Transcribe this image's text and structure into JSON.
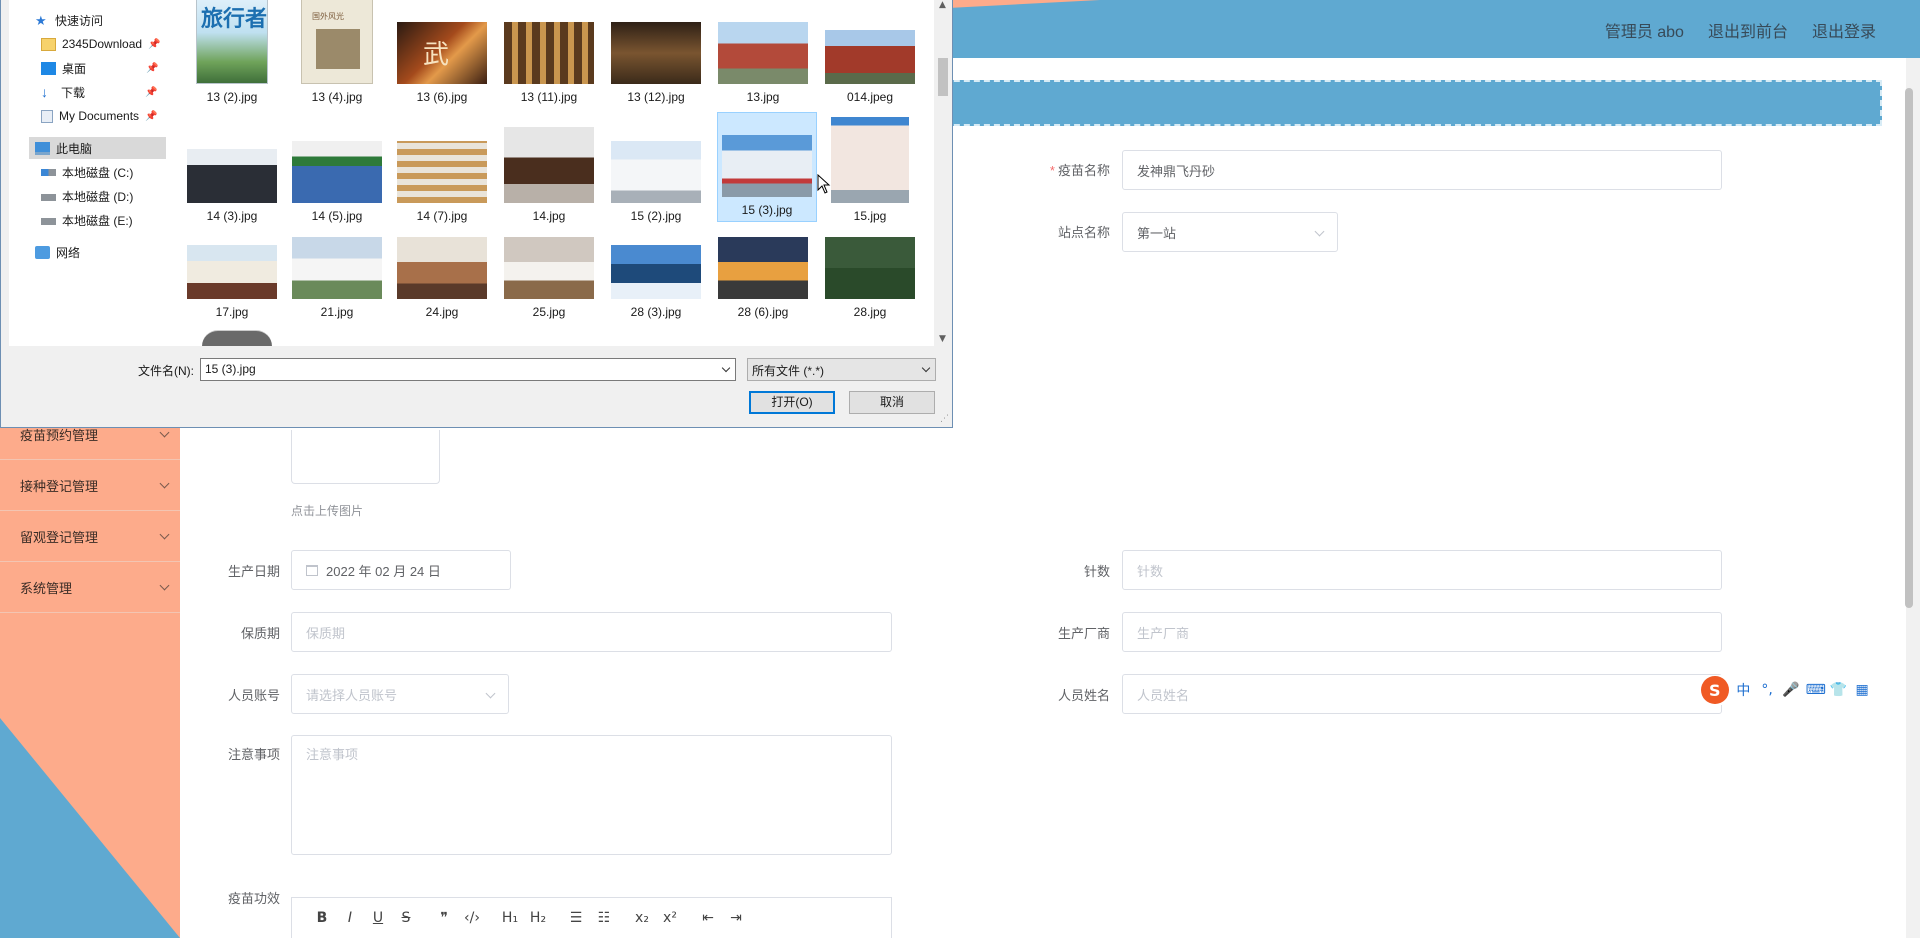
{
  "header": {
    "nav": [
      "管理员 abo",
      "退出到前台",
      "退出登录"
    ]
  },
  "sidebar": {
    "items": [
      "疫苗预约管理",
      "接种登记管理",
      "留观登记管理",
      "系统管理"
    ]
  },
  "form": {
    "vaccine_name": {
      "label": "疫苗名称",
      "value": "发神鼎飞丹砂"
    },
    "site_name": {
      "label": "站点名称",
      "value": "第一站"
    },
    "upload_hint": "点击上传图片",
    "prod_date": {
      "label": "生产日期",
      "value": "2022 年 02 月 24 日"
    },
    "doses": {
      "label": "针数",
      "placeholder": "针数"
    },
    "shelf_life": {
      "label": "保质期",
      "placeholder": "保质期"
    },
    "manufacturer": {
      "label": "生产厂商",
      "placeholder": "生产厂商"
    },
    "staff_account": {
      "label": "人员账号",
      "placeholder": "请选择人员账号"
    },
    "staff_name": {
      "label": "人员姓名",
      "placeholder": "人员姓名"
    },
    "notes": {
      "label": "注意事项",
      "placeholder": "注意事项"
    },
    "efficacy": {
      "label": "疫苗功效"
    }
  },
  "editor_toolbar": [
    "B",
    "I",
    "U",
    "S",
    "❞",
    "‹/›",
    "H₁",
    "H₂",
    "☰",
    "☷",
    "x₂",
    "x²",
    "⇤",
    "⇥"
  ],
  "ime": {
    "logo": "S",
    "glyphs": [
      "中",
      "°,",
      "🎤",
      "⌨",
      "👕",
      "▦"
    ]
  },
  "dialog": {
    "nav": {
      "quick_access": "快速访问",
      "folders": [
        {
          "label": "2345Download",
          "icon": "folder-icon"
        },
        {
          "label": "桌面",
          "icon": "desktop-icon"
        },
        {
          "label": "下载",
          "icon": "download-icon"
        },
        {
          "label": "My Documents",
          "icon": "document-icon"
        }
      ],
      "this_pc": "此电脑",
      "drives": [
        "本地磁盘 (C:)",
        "本地磁盘 (D:)",
        "本地磁盘 (E:)"
      ],
      "network": "网络"
    },
    "files": [
      "13 (2).jpg",
      "13 (4).jpg",
      "13 (6).jpg",
      "13 (11).jpg",
      "13 (12).jpg",
      "13.jpg",
      "014.jpeg",
      "14 (3).jpg",
      "14 (5).jpg",
      "14 (7).jpg",
      "14.jpg",
      "15 (2).jpg",
      "15 (3).jpg",
      "15.jpg",
      "17.jpg",
      "21.jpg",
      "24.jpg",
      "25.jpg",
      "28 (3).jpg",
      "28 (6).jpg",
      "28.jpg"
    ],
    "selected_file": "15 (3).jpg",
    "thumb_texts": {
      "magazine": "旅行者",
      "book": "国外风光",
      "poster": "武"
    },
    "filename_label": "文件名(N):",
    "filename_value": "15 (3).jpg",
    "filetype_value": "所有文件 (*.*)",
    "open_label": "打开(O)",
    "cancel_label": "取消"
  },
  "colors": {
    "accent_blue": "#5fa9d1",
    "peach": "#fdab8b",
    "selection": "#cce8ff"
  }
}
